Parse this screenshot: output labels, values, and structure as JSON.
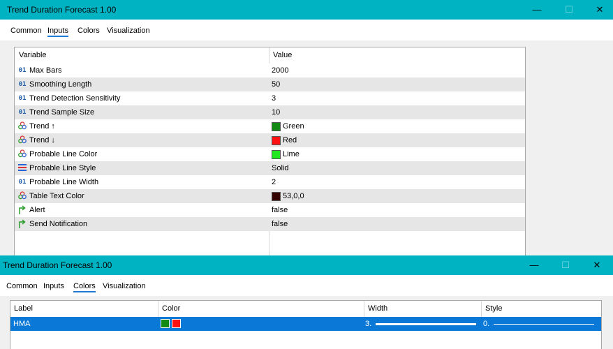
{
  "dialog1": {
    "title": "Trend Duration Forecast 1.00",
    "tabs": [
      "Common",
      "Inputs",
      "Colors",
      "Visualization"
    ],
    "active_tab": "Inputs",
    "columns": [
      "Variable",
      "Value"
    ],
    "rows": [
      {
        "icon": "int-icon",
        "name": "Max Bars",
        "value": "2000"
      },
      {
        "icon": "int-icon",
        "name": "Smoothing Length",
        "value": "50"
      },
      {
        "icon": "int-icon",
        "name": "Trend Detection Sensitivity",
        "value": "3"
      },
      {
        "icon": "int-icon",
        "name": "Trend Sample Size",
        "value": "10"
      },
      {
        "icon": "color-icon",
        "name": "Trend ↑",
        "value": "Green",
        "swatch": "#138a13"
      },
      {
        "icon": "color-icon",
        "name": "Trend ↓",
        "value": "Red",
        "swatch": "#ff1010"
      },
      {
        "icon": "color-icon",
        "name": "Probable Line Color",
        "value": "Lime",
        "swatch": "#22e822"
      },
      {
        "icon": "line-style-icon",
        "name": "Probable Line Style",
        "value": "Solid"
      },
      {
        "icon": "int-icon",
        "name": "Probable Line Width",
        "value": "2"
      },
      {
        "icon": "color-icon",
        "name": "Table Text Color",
        "value": "53,0,0",
        "swatch": "#350000"
      },
      {
        "icon": "bool-icon",
        "name": "Alert",
        "value": "false"
      },
      {
        "icon": "bool-icon",
        "name": "Send Notification",
        "value": "false"
      }
    ]
  },
  "dialog2": {
    "title": "Trend Duration Forecast 1.00",
    "tabs": [
      "Common",
      "Inputs",
      "Colors",
      "Visualization"
    ],
    "active_tab": "Colors",
    "columns": [
      "Label",
      "Color",
      "Width",
      "Style"
    ],
    "row": {
      "label": "HMA",
      "colors": [
        "#138a13",
        "#ff1010"
      ],
      "width": "3.",
      "style": "0."
    }
  },
  "icons": {
    "int": "01",
    "minimize": "—",
    "maximize": "☐",
    "close": "✕"
  },
  "colors": {
    "titlebar": "#00b3c3",
    "selection": "#0a78d7",
    "tab_underline": "#1e7ad4"
  }
}
